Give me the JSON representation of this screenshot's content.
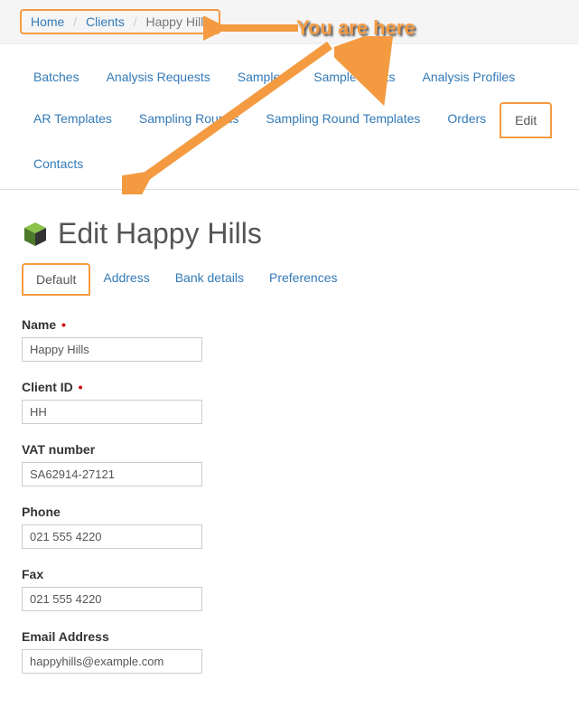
{
  "breadcrumb": {
    "home": "Home",
    "clients": "Clients",
    "current": "Happy Hills"
  },
  "annotation": {
    "you_are_here": "You are here"
  },
  "topTabs": {
    "batches": "Batches",
    "analysis_requests": "Analysis Requests",
    "samples": "Samples",
    "sample_points": "Sample Points",
    "analysis_profiles": "Analysis Profiles",
    "ar_templates": "AR Templates",
    "sampling_rounds": "Sampling Rounds",
    "sampling_round_templates": "Sampling Round Templates",
    "orders": "Orders",
    "edit": "Edit",
    "contacts": "Contacts"
  },
  "heading": "Edit Happy Hills",
  "subTabs": {
    "default": "Default",
    "address": "Address",
    "bank_details": "Bank details",
    "preferences": "Preferences"
  },
  "form": {
    "name": {
      "label": "Name",
      "value": "Happy Hills",
      "required": true
    },
    "client_id": {
      "label": "Client ID",
      "value": "HH",
      "required": true
    },
    "vat_number": {
      "label": "VAT number",
      "value": "SA62914-27121",
      "required": false
    },
    "phone": {
      "label": "Phone",
      "value": "021 555 4220",
      "required": false
    },
    "fax": {
      "label": "Fax",
      "value": "021 555 4220",
      "required": false
    },
    "email": {
      "label": "Email Address",
      "value": "happyhills@example.com",
      "required": false
    }
  }
}
